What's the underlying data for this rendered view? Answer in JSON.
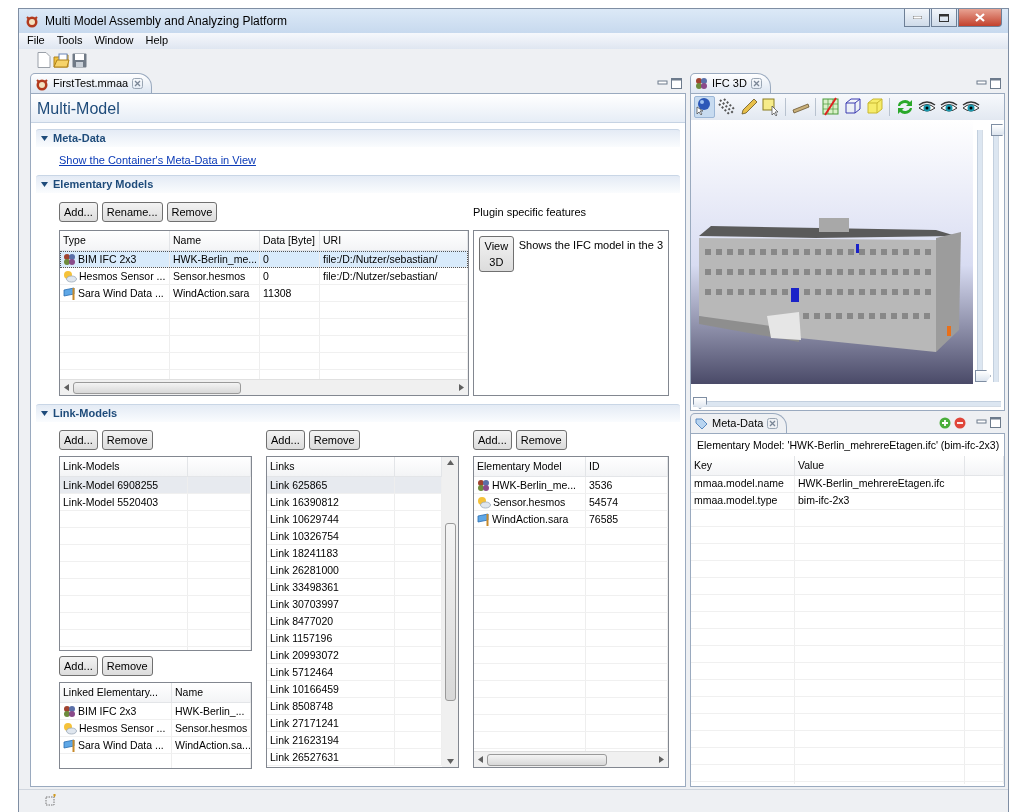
{
  "window": {
    "title": "Multi Model Assembly and Analyzing Platform"
  },
  "menu": [
    "File",
    "Tools",
    "Window",
    "Help"
  ],
  "editor": {
    "tab": {
      "title": "FirstTest.mmaa",
      "selected": true
    },
    "header": "Multi-Model",
    "meta_section": {
      "title": "Meta-Data",
      "expanded": true,
      "link": "Show the Container's Meta-Data in View"
    },
    "elementary_section": {
      "title": "Elementary Models",
      "expanded": true,
      "buttons": [
        "Add...",
        "Rename...",
        "Remove"
      ],
      "table": {
        "columns": [
          "Type",
          "Name",
          "Data [Byte]",
          "URI"
        ],
        "rows": [
          {
            "kind": "ifc",
            "cells": [
              "BIM IFC 2x3",
              "HWK-Berlin_me...",
              "0",
              "file:/D:/Nutzer/sebastian/"
            ],
            "selected": true
          },
          {
            "kind": "sensor",
            "cells": [
              "Hesmos Sensor ...",
              "Sensor.hesmos",
              "0",
              "file:/D:/Nutzer/sebastian/"
            ],
            "selected": false
          },
          {
            "kind": "wind",
            "cells": [
              "Sara Wind Data ...",
              "WindAction.sara",
              "11308",
              ""
            ],
            "selected": false
          }
        ]
      },
      "plugin": {
        "label": "Plugin specific features",
        "button": "View 3D",
        "text": "Shows the IFC model in the 3"
      }
    },
    "link_section": {
      "title": "Link-Models",
      "expanded": true,
      "link_models": {
        "buttons": [
          "Add...",
          "Remove"
        ],
        "table": {
          "columns": [
            "Link-Models"
          ],
          "rows": [
            {
              "cells": [
                "Link-Model 6908255"
              ],
              "selected": true
            },
            {
              "cells": [
                "Link-Model 5520403"
              ],
              "selected": false
            }
          ]
        }
      },
      "linked_elements": {
        "buttons": [
          "Add...",
          "Remove"
        ],
        "table": {
          "columns": [
            "Linked Elementary...",
            "Name"
          ],
          "rows": [
            {
              "kind": "ifc",
              "cells": [
                "BIM IFC 2x3",
                "HWK-Berlin_..."
              ],
              "selected": false
            },
            {
              "kind": "sensor",
              "cells": [
                "Hesmos Sensor ...",
                "Sensor.hesmos"
              ],
              "selected": false
            },
            {
              "kind": "wind",
              "cells": [
                "Sara Wind Data ...",
                "WindAction.sa..."
              ],
              "selected": false
            }
          ]
        }
      },
      "links": {
        "buttons": [
          "Add...",
          "Remove"
        ],
        "table": {
          "columns": [
            "Links"
          ],
          "rows": [
            {
              "cells": [
                "Link 625865"
              ],
              "selected": true
            },
            {
              "cells": [
                "Link 16390812"
              ],
              "selected": false
            },
            {
              "cells": [
                "Link 10629744"
              ],
              "selected": false
            },
            {
              "cells": [
                "Link 10326754"
              ],
              "selected": false
            },
            {
              "cells": [
                "Link 18241183"
              ],
              "selected": false
            },
            {
              "cells": [
                "Link 26281000"
              ],
              "selected": false
            },
            {
              "cells": [
                "Link 33498361"
              ],
              "selected": false
            },
            {
              "cells": [
                "Link 30703997"
              ],
              "selected": false
            },
            {
              "cells": [
                "Link 8477020"
              ],
              "selected": false
            },
            {
              "cells": [
                "Link 1157196"
              ],
              "selected": false
            },
            {
              "cells": [
                "Link 20993072"
              ],
              "selected": false
            },
            {
              "cells": [
                "Link 5712464"
              ],
              "selected": false
            },
            {
              "cells": [
                "Link 10166459"
              ],
              "selected": false
            },
            {
              "cells": [
                "Link 8508748"
              ],
              "selected": false
            },
            {
              "cells": [
                "Link 27171241"
              ],
              "selected": false
            },
            {
              "cells": [
                "Link 21623194"
              ],
              "selected": false
            },
            {
              "cells": [
                "Link 26527631"
              ],
              "selected": false
            }
          ]
        }
      },
      "elements": {
        "buttons": [
          "Add...",
          "Remove"
        ],
        "table": {
          "columns": [
            "Elementary Model",
            "ID"
          ],
          "rows": [
            {
              "kind": "ifc",
              "cells": [
                "HWK-Berlin_me...",
                "3536"
              ],
              "selected": false
            },
            {
              "kind": "sensor",
              "cells": [
                "Sensor.hesmos",
                "54574"
              ],
              "selected": false
            },
            {
              "kind": "wind",
              "cells": [
                "WindAction.sara",
                "76585"
              ],
              "selected": false
            }
          ]
        }
      }
    }
  },
  "ifc_view": {
    "tab": {
      "title": "IFC 3D"
    },
    "tools": [
      {
        "kind": "sphere-cursor",
        "selected": true
      },
      {
        "kind": "dotted-cursor",
        "selected": false
      },
      {
        "kind": "pencil",
        "selected": false
      },
      {
        "kind": "select-box",
        "selected": false
      },
      {
        "kind": "ruler",
        "selected": false
      },
      {
        "kind": "grid-plane",
        "selected": false
      },
      {
        "kind": "wire-cube",
        "selected": false
      },
      {
        "kind": "solid-cube",
        "selected": false
      },
      {
        "kind": "refresh",
        "selected": false
      },
      {
        "kind": "eye",
        "selected": false
      },
      {
        "kind": "eye",
        "selected": false
      },
      {
        "kind": "eye",
        "selected": false
      }
    ],
    "sliders": [
      {
        "kind": "vertical",
        "level": 0
      },
      {
        "kind": "vertical",
        "level": 1
      },
      {
        "kind": "horizontal",
        "level": 0
      }
    ]
  },
  "meta_view": {
    "tab": {
      "title": "Meta-Data"
    },
    "caption": "Elementary Model: 'HWK-Berlin_mehrereEtagen.ifc' (bim-ifc-2x3)",
    "table": {
      "columns": [
        "Key",
        "Value"
      ],
      "rows": [
        {
          "cells": [
            "mmaa.model.name",
            "HWK-Berlin_mehrereEtagen.ifc"
          ],
          "selected": false
        },
        {
          "cells": [
            "mmaa.model.type",
            "bim-ifc-2x3"
          ],
          "selected": false
        }
      ]
    }
  }
}
